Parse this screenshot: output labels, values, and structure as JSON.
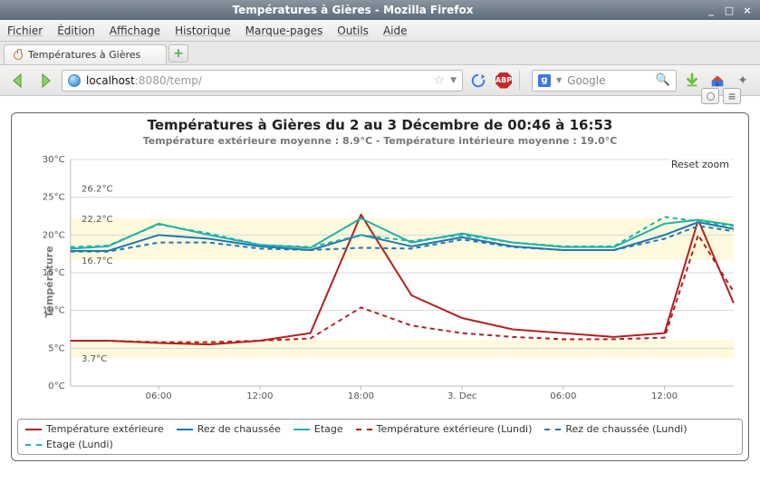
{
  "window": {
    "title": "Températures à Gières - Mozilla Firefox",
    "min": "_",
    "max": "□",
    "close": "×"
  },
  "menu": {
    "file": "Fichier",
    "edit": "Édition",
    "view": "Affichage",
    "history": "Historique",
    "bookmarks": "Marque-pages",
    "tools": "Outils",
    "help": "Aide"
  },
  "tab": {
    "label": "Températures à Gières",
    "new": "+"
  },
  "url": {
    "host": "localhost",
    "port": ":8080",
    "path": "/temp/",
    "star": "☆"
  },
  "search": {
    "engine": "g",
    "placeholder": "Google",
    "mag": "🔍"
  },
  "chart": {
    "title": "Températures à Gières du 2 au 3 Décembre de 00:46 à 16:53",
    "subtitle": "Température extérieure moyenne : 8.9°C - Température intérieure moyenne : 19.0°C",
    "ylabel": "Température",
    "reset": "Reset zoom",
    "ann_16_7": "16.7°C",
    "ann_26_2": "26.2°C",
    "ann_22_2": "22.2°C",
    "ann_3_7": "3.7°C",
    "menu_btn": "≡"
  },
  "legend": {
    "ext": "Température extérieure",
    "rdc": "Rez de chaussée",
    "etage": "Etage",
    "ext_l": "Température extérieure (Lundi)",
    "rdc_l": "Rez de chaussée (Lundi)",
    "etage_l": "Etage (Lundi)"
  },
  "chart_data": {
    "type": "line",
    "title": "Températures à Gières du 2 au 3 Décembre de 00:46 à 16:53",
    "ylabel": "Température",
    "ylim": [
      0,
      30
    ],
    "yticks": [
      "0°C",
      "5°C",
      "10°C",
      "15°C",
      "20°C",
      "25°C",
      "30°C"
    ],
    "xticks": [
      "06:00",
      "12:00",
      "18:00",
      "3. Dec",
      "06:00",
      "12:00"
    ],
    "x_hours": [
      0.77,
      3,
      6,
      9,
      12,
      15,
      18,
      21,
      24,
      27,
      30,
      33,
      36,
      38,
      40.1
    ],
    "series": [
      {
        "name": "Température extérieure",
        "color": "#b22222",
        "dash": "solid",
        "values": [
          6,
          6,
          5.7,
          5.5,
          6,
          7,
          22.7,
          12,
          9,
          7.5,
          7,
          6.5,
          7,
          22,
          11
        ]
      },
      {
        "name": "Rez de chaussée",
        "color": "#1f77b4",
        "dash": "solid",
        "values": [
          17.9,
          17.9,
          20,
          19.5,
          18.5,
          18,
          20,
          18.5,
          19.7,
          18.5,
          18,
          18,
          20,
          21.7,
          20.8
        ]
      },
      {
        "name": "Etage",
        "color": "#20b2aa",
        "dash": "solid",
        "values": [
          18.2,
          18.5,
          21.5,
          20,
          18.7,
          18.3,
          22.2,
          19,
          20.2,
          19,
          18.4,
          18.4,
          21.5,
          22,
          21.3
        ]
      },
      {
        "name": "Température extérieure (Lundi)",
        "color": "#b22222",
        "dash": "dashed",
        "values": [
          6,
          6,
          5.8,
          5.8,
          6,
          6.3,
          10.4,
          8,
          7,
          6.5,
          6.2,
          6.2,
          6.4,
          20,
          12.5
        ]
      },
      {
        "name": "Rez de chaussée (Lundi)",
        "color": "#1f77b4",
        "dash": "dashed",
        "values": [
          17.8,
          17.8,
          19,
          19,
          18.2,
          18,
          18.3,
          18.2,
          19.4,
          18.4,
          18,
          18,
          19.5,
          21.2,
          20.5
        ]
      },
      {
        "name": "Etage (Lundi)",
        "color": "#20b2aa",
        "dash": "dashed",
        "values": [
          18.4,
          18.6,
          21.4,
          20.2,
          18.7,
          18.4,
          20,
          19.2,
          20,
          19,
          18.5,
          18.5,
          22.4,
          21.8,
          21.2
        ]
      }
    ],
    "annotations": [
      {
        "label": "16.7°C",
        "y": 16.7
      },
      {
        "label": "26.2°C",
        "y": 26.2
      },
      {
        "label": "22.2°C",
        "y": 22.2
      },
      {
        "label": "3.7°C",
        "y": 3.7
      }
    ],
    "plot_bands_y": [
      [
        16.7,
        22.2
      ],
      [
        3.7,
        6.1
      ]
    ]
  }
}
